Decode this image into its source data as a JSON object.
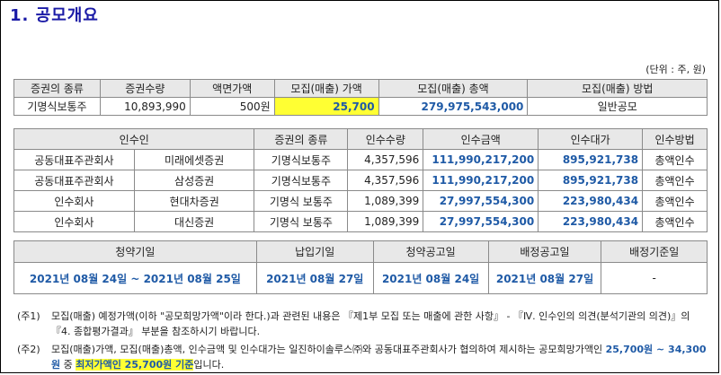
{
  "title": "1. 공모개요",
  "unit": "(단위 : 주, 원)",
  "offering": {
    "headers": [
      "증권의 종류",
      "증권수량",
      "액면가액",
      "모집(매출) 가액",
      "모집(매출) 총액",
      "모집(매출) 방법"
    ],
    "row": {
      "type": "기명식보통주",
      "qty": "10,893,990",
      "par": "500원",
      "price": "25,700",
      "total": "279,975,543,000",
      "method": "일반공모"
    }
  },
  "underwriters": {
    "headers": [
      "인수인",
      "증권의 종류",
      "인수수량",
      "인수금액",
      "인수대가",
      "인수방법"
    ],
    "rows": [
      {
        "role": "공동대표주관회사",
        "name": "미래에셋증권",
        "type": "기명식보통주",
        "qty": "4,357,596",
        "amount": "111,990,217,200",
        "fee": "895,921,738",
        "method": "총액인수"
      },
      {
        "role": "공동대표주관회사",
        "name": "삼성증권",
        "type": "기명식보통주",
        "qty": "4,357,596",
        "amount": "111,990,217,200",
        "fee": "895,921,738",
        "method": "총액인수"
      },
      {
        "role": "인수회사",
        "name": "현대차증권",
        "type": "기명식 보통주",
        "qty": "1,089,399",
        "amount": "27,997,554,300",
        "fee": "223,980,434",
        "method": "총액인수"
      },
      {
        "role": "인수회사",
        "name": "대신증권",
        "type": "기명식 보통주",
        "qty": "1,089,399",
        "amount": "27,997,554,300",
        "fee": "223,980,434",
        "method": "총액인수"
      }
    ]
  },
  "schedule": {
    "headers": [
      "청약기일",
      "납입기일",
      "청약공고일",
      "배정공고일",
      "배정기준일"
    ],
    "values": [
      "2021년 08월 24일 ~ 2021년 08월 25일",
      "2021년 08월 27일",
      "2021년 08월 24일",
      "2021년 08월 27일",
      "-"
    ]
  },
  "notes": {
    "n1_label": "(주1)",
    "n1_text": "모집(매출) 예정가액(이하 \"공모희망가액\"이라 한다.)과 관련된 내용은 『제1부 모집 또는 매출에 관한 사항』 - 『Ⅳ. 인수인의 의견(분석기관의 의견)』의 『4. 종합평가결과』 부분을 참조하시기 바랍니다.",
    "n2_label": "(주2)",
    "n2_pre": "모집(매출)가액, 모집(매출)총액, 인수금액 및 인수대가는 일진하이솔루스㈜와 공동대표주관회사가 협의하여 제시하는 공모희망가액인 ",
    "n2_range": "25,700원 ~ 34,300원",
    "n2_mid": " 중 ",
    "n2_hl": "최저가액인 25,700원 기준",
    "n2_post": "입니다."
  }
}
